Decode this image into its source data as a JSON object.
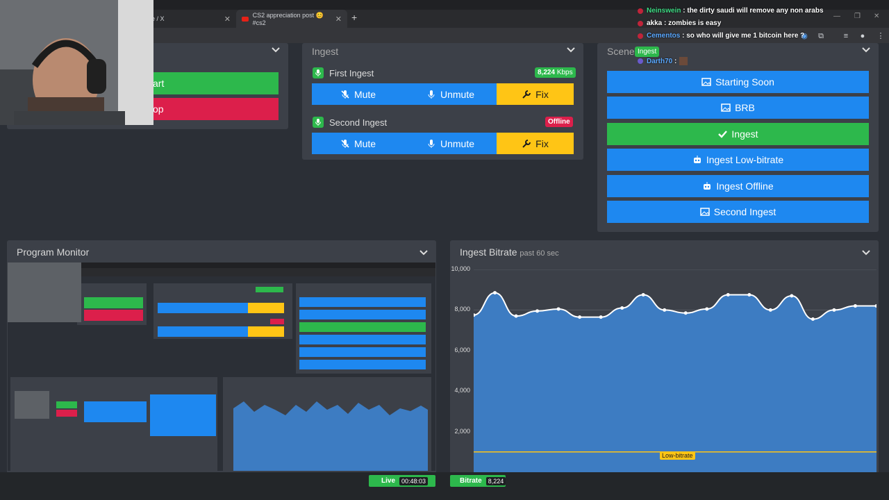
{
  "browser": {
    "tabs": [
      {
        "label": "e / X"
      },
      {
        "label": "CS2 appreciation post 😊 #cs2"
      }
    ],
    "new_tab": "+"
  },
  "control_panel": {
    "start_label": "art",
    "stop_label": "op"
  },
  "ingest_panel": {
    "title": "Ingest",
    "ingests": [
      {
        "name": "First Ingest",
        "badge": "8,224",
        "badge_unit": "Kbps",
        "mute": "Mute",
        "unmute": "Unmute",
        "fix": "Fix"
      },
      {
        "name": "Second Ingest",
        "badge": "Offline",
        "mute": "Mute",
        "unmute": "Unmute",
        "fix": "Fix"
      }
    ]
  },
  "scene_panel": {
    "title": "Scene",
    "active_tag": "Ingest",
    "scenes": [
      {
        "label": "Starting Soon",
        "icon": "image-icon"
      },
      {
        "label": "BRB",
        "icon": "image-icon"
      },
      {
        "label": "Ingest",
        "icon": "check-icon"
      },
      {
        "label": "Ingest Low-bitrate",
        "icon": "robot-icon"
      },
      {
        "label": "Ingest Offline",
        "icon": "robot-icon"
      },
      {
        "label": "Second Ingest",
        "icon": "image-icon"
      }
    ]
  },
  "program_monitor": {
    "title": "Program Monitor"
  },
  "bitrate_panel": {
    "title": "Ingest Bitrate",
    "subtitle": "past 60 sec",
    "threshold_label": "Low-bitrate"
  },
  "chat": {
    "messages": [
      {
        "user": "Neinswein",
        "text": ": the dirty saudi will remove any non arabs",
        "color": "#3ddc84"
      },
      {
        "user": "akka",
        "text": ": zombies is easy",
        "color": "#ffffff"
      },
      {
        "user": "Cementos",
        "text": ": so who will give me 1 bitcoin here ?",
        "color": "#5aa8ff"
      },
      {
        "user": "Darth70",
        "text": ":",
        "color": "#5aa8ff"
      }
    ]
  },
  "status_bar": {
    "live_label": "Live",
    "live_time": "00:48:03",
    "bitrate_label": "Bitrate",
    "bitrate_value": "8,224"
  },
  "chart_data": {
    "type": "area",
    "title": "Ingest Bitrate",
    "ylim": [
      0,
      10000
    ],
    "yticks": [
      "10,000",
      "8,000",
      "6,000",
      "4,000",
      "2,000"
    ],
    "ytick_values": [
      10000,
      8000,
      6000,
      4000,
      2000
    ],
    "values": [
      7750,
      8850,
      7700,
      7950,
      8050,
      7650,
      7650,
      8100,
      8750,
      8000,
      7850,
      8050,
      8750,
      8750,
      8000,
      8700,
      7550,
      8000,
      8200,
      8200
    ],
    "threshold": 1000,
    "threshold_label": "Low-bitrate",
    "fill_color": "#3d7cc2",
    "line_color": "#ffffff",
    "grid": true
  }
}
